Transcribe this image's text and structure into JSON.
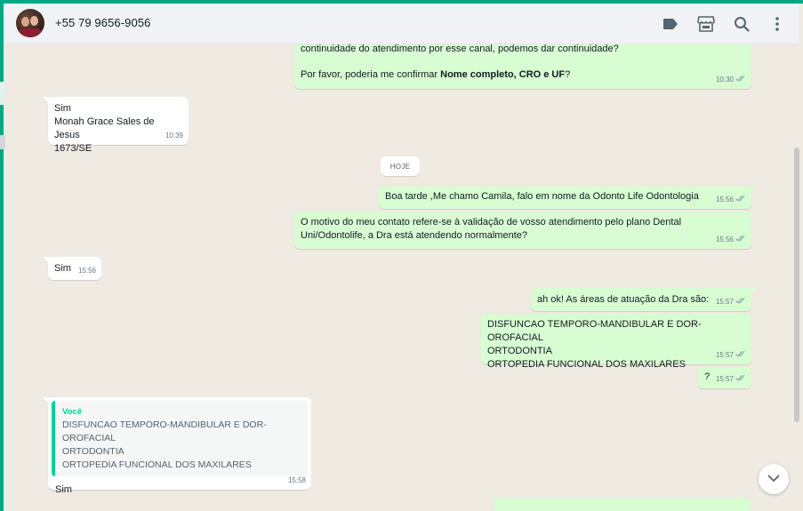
{
  "header": {
    "contact_name": "+55 79 9656-9056",
    "icons": [
      "label-icon",
      "store-icon",
      "search-icon",
      "menu-icon"
    ]
  },
  "messages": [
    {
      "direction": "out",
      "text_plain_a": "continuidade do atendimento por esse canal, podemos dar continuidade?",
      "text_plain_b": "Por favor, poderia me confirmar ",
      "text_bold": "Nome completo, CRO e UF",
      "text_plain_c": "?",
      "time": "10:30"
    },
    {
      "direction": "in",
      "text": "Sim\nMonah Grace Sales de Jesus\n1673/SE",
      "time": "10:39"
    },
    {
      "direction": "out",
      "text": "Boa tarde ,Me chamo Camila, falo em nome da Odonto Life Odontologia",
      "time": "15:56"
    },
    {
      "direction": "out",
      "text": "O motivo do meu contato refere-se à validação de vosso atendimento pelo plano Dental\nUni/Odontolife, a Dra está atendendo normalmente?",
      "time": "15:56"
    },
    {
      "direction": "in",
      "text": "Sim",
      "time": "15:56"
    },
    {
      "direction": "out",
      "text": "ah ok! As áreas de atuação da Dra são:",
      "time": "15:57"
    },
    {
      "direction": "out",
      "text": "DISFUNCAO TEMPORO-MANDIBULAR E DOR-OROFACIAL\nORTODONTIA\nORTOPEDIA FUNCIONAL DOS MAXILARES",
      "time": "15:57"
    },
    {
      "direction": "out",
      "text": "?",
      "time": "15:57"
    },
    {
      "direction": "in",
      "quote_author": "Você",
      "quote_text": "DISFUNCAO TEMPORO-MANDIBULAR E DOR-OROFACIAL\nORTODONTIA\nORTOPEDIA FUNCIONAL DOS MAXILARES",
      "text": "Sim",
      "time": "15:58"
    }
  ],
  "date_chip": "HOJE",
  "colors": {
    "accent": "#00a884",
    "outgoing_bubble": "#d9fdd3",
    "incoming_bubble": "#ffffff",
    "quote_bar": "#06cf9c",
    "read_ticks": "#53bdeb"
  }
}
